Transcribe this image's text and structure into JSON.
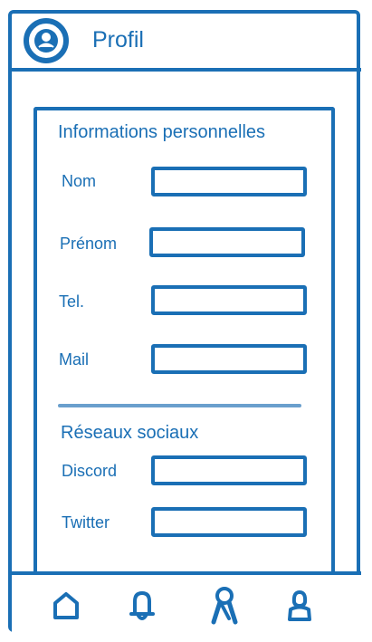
{
  "header": {
    "title": "Profil",
    "avatar_icon": "user-avatar-icon"
  },
  "personal_info": {
    "title": "Informations personnelles",
    "fields": [
      {
        "label": "Nom",
        "value": ""
      },
      {
        "label": "Prénom",
        "value": ""
      },
      {
        "label": "Tel.",
        "value": ""
      },
      {
        "label": "Mail",
        "value": ""
      }
    ]
  },
  "social": {
    "title": "Réseaux sociaux",
    "fields": [
      {
        "label": "Discord",
        "value": ""
      },
      {
        "label": "Twitter",
        "value": ""
      }
    ]
  },
  "bottom_nav": {
    "items": [
      {
        "icon": "home-icon"
      },
      {
        "icon": "bell-icon"
      },
      {
        "icon": "award-ribbon-icon"
      },
      {
        "icon": "user-icon"
      }
    ]
  },
  "colors": {
    "primary": "#1a6fb5",
    "divider": "#6a9fcd",
    "background": "#ffffff"
  }
}
